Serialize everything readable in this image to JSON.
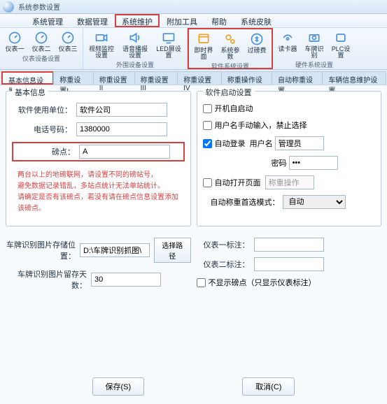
{
  "title": "系统参数设置",
  "menus": [
    "系统管理",
    "数据管理",
    "系统维护",
    "附加工具",
    "帮助",
    "系统皮肤"
  ],
  "ribbon": [
    {
      "group": "仪表设备设置",
      "items": [
        {
          "n": "meter1",
          "l": "仪表一"
        },
        {
          "n": "meter2",
          "l": "仪表二"
        },
        {
          "n": "meter3",
          "l": "仪表三"
        }
      ]
    },
    {
      "group": "外围设备设置",
      "items": [
        {
          "n": "video",
          "l": "视频监控设置",
          "w": 1
        },
        {
          "n": "voice",
          "l": "语音播报设置",
          "w": 1
        },
        {
          "n": "led",
          "l": "LED屏设置",
          "w": 1
        }
      ]
    },
    {
      "group": "软件系统设置",
      "items": [
        {
          "n": "ui",
          "l": "即时界面"
        },
        {
          "n": "param",
          "l": "系统参数"
        },
        {
          "n": "fee",
          "l": "过磅费"
        }
      ]
    },
    {
      "group": "硬件系统设置",
      "items": [
        {
          "n": "reader",
          "l": "读卡器"
        },
        {
          "n": "plate",
          "l": "车牌识别"
        },
        {
          "n": "plc",
          "l": "PLC设置"
        }
      ]
    }
  ],
  "tabs": [
    "基本信息设置",
    "称重设置I",
    "称重设置II",
    "称重设置III",
    "称重设置IV",
    "称重操作设置",
    "自动称重设置",
    "车辆信息维护设置"
  ],
  "basic": {
    "legend": "基本信息",
    "unit_l": "软件使用单位：",
    "unit_v": "软件公司",
    "tel_l": "电话号码：",
    "tel_v": "1380000",
    "site_l": "磅点：",
    "site_v": "A",
    "warn1": "两台以上的地磅联网，请设置不同的磅站号，",
    "warn2": "避免数据记录错乱，多站点统计无法单站统计。",
    "warn3": "请确定是否有该磅点，若没有请在磅点信息设置添加该磅点。"
  },
  "startup": {
    "legend": "软件启动设置",
    "auto_start": "开机自启动",
    "no_manual": "用户名手动输入，禁止选择",
    "auto_login": "自动登录",
    "user_l": "用户名",
    "user_v": "管理员",
    "pwd_l": "密码",
    "pwd_v": "***",
    "auto_open": "自动打开页面",
    "page_v": "称重操作",
    "mode_l": "自动称重首选模式：",
    "mode_v": "自动"
  },
  "pic": {
    "path_l": "车牌识别图片存储位置：",
    "path_v": "D:\\车牌识别抓图\\",
    "browse": "选择路径",
    "days_l": "车牌识别图片留存天数：",
    "days_v": "30"
  },
  "marks": {
    "m1": "仪表一标注：",
    "m2": "仪表二标注：",
    "hide": "不显示磅点（只显示仪表标注）"
  },
  "btn": {
    "save": "保存(S)",
    "cancel": "取消(C)"
  }
}
